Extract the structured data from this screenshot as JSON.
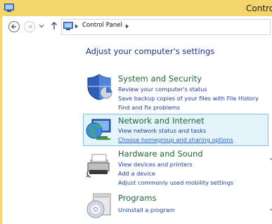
{
  "window": {
    "title": "Control"
  },
  "address_bar": {
    "path": "Control Panel"
  },
  "page": {
    "heading": "Adjust your computer's settings"
  },
  "categories": [
    {
      "title": "System and Security",
      "icon": "shield-icon",
      "links": [
        "Review your computer's status",
        "Save backup copies of your files with File History",
        "Find and fix problems"
      ]
    },
    {
      "title": "Network and Internet",
      "icon": "globe-network-icon",
      "links": [
        "View network status and tasks",
        "Choose homegroup and sharing options"
      ]
    },
    {
      "title": "Hardware and Sound",
      "icon": "printer-icon",
      "links": [
        "View devices and printers",
        "Add a device",
        "Adjust commonly used mobility settings"
      ]
    },
    {
      "title": "Programs",
      "icon": "disc-programs-icon",
      "links": [
        "Uninstall a program"
      ]
    }
  ],
  "colors": {
    "titlebar": "#f3d76e",
    "heading": "#1e3287",
    "category_title": "#1e6a30",
    "link": "#1f3f9e",
    "highlight": "#e5f3fb"
  }
}
